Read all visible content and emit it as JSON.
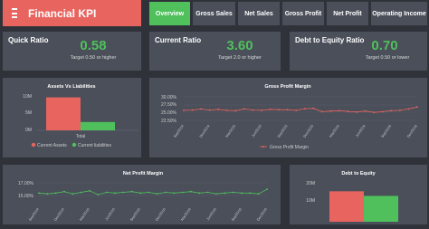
{
  "app": {
    "title": "Financial KPI",
    "menu_icon": "hamburger-icon"
  },
  "tabs": [
    {
      "label": "Overview",
      "active": true
    },
    {
      "label": "Gross Sales",
      "active": false
    },
    {
      "label": "Net Sales",
      "active": false
    },
    {
      "label": "Gross Profit",
      "active": false
    },
    {
      "label": "Net Profit",
      "active": false
    },
    {
      "label": "Operating Income",
      "active": false
    }
  ],
  "kpis": [
    {
      "label": "Quick Ratio",
      "value": "0.58",
      "target": "Target 0.50 or higher"
    },
    {
      "label": "Current Ratio",
      "value": "3.60",
      "target": "Target 2.0 or higher"
    },
    {
      "label": "Debt to Equity Ratio",
      "value": "0.70",
      "target": "Target 0.50 or lower"
    }
  ],
  "colors": {
    "accent_red": "#e8645f",
    "accent_green": "#4fc05b",
    "panel": "#4a4f5a",
    "background": "#2f3239"
  },
  "charts": {
    "assets_liabilities": {
      "title": "Assets Vs Liabilities",
      "y_ticks": [
        "10M",
        "5M",
        "0M"
      ],
      "category": "Total",
      "legend": [
        "Current Assets",
        "Current liabilities"
      ]
    },
    "gross_margin": {
      "title": "Gross Profit Margin",
      "y_ticks": [
        "30.00%",
        "27.50%",
        "25.00%",
        "22.50%"
      ],
      "legend": "Gross Profit Margin"
    },
    "net_margin": {
      "title": "Net Profit Margin",
      "y_ticks": [
        "17.00%",
        "15.00%"
      ]
    },
    "debt_equity": {
      "title": "Debt to Equity",
      "y_ticks": [
        "20M",
        "10M"
      ]
    }
  },
  "chart_data": [
    {
      "type": "bar",
      "title": "Assets Vs Liabilities",
      "categories": [
        "Total"
      ],
      "series": [
        {
          "name": "Current Assets",
          "values": [
            9.5
          ],
          "color": "#e8645f"
        },
        {
          "name": "Current liabilities",
          "values": [
            2.4
          ],
          "color": "#4fc05b"
        }
      ],
      "ylim": [
        0,
        12
      ],
      "y_unit": "M"
    },
    {
      "type": "line",
      "title": "Gross Profit Margin",
      "x": [
        "Sep/2014",
        "Oct/2014",
        "Nov/2014",
        "Dec/2014",
        "Jan/2015",
        "Feb/2015",
        "Mar/2015",
        "Apr/2015",
        "May/2015",
        "Jun/2015",
        "Jul/2015",
        "Aug/2015",
        "Sep/2015",
        "Oct/2015",
        "Nov/2015",
        "Dec/2015",
        "Jan/2016",
        "Feb/2016",
        "Mar/2016",
        "Apr/2016",
        "May/2016",
        "Jun/2016",
        "Jul/2016",
        "Aug/2016",
        "Sep/2016",
        "Oct/2016",
        "Nov/2016",
        "Dec/2016"
      ],
      "x_tick_labels": [
        "Sep/2014",
        "Dec/2014",
        "Mar/2015",
        "Jun/2015",
        "Sep/2015",
        "Dec/2015",
        "Mar/2016",
        "Jun/2016",
        "Sep/2016",
        "Dec/2016"
      ],
      "series": [
        {
          "name": "Gross Profit Margin",
          "color": "#e8645f",
          "values": [
            26.0,
            26.1,
            26.4,
            26.1,
            26.3,
            26.0,
            25.9,
            26.4,
            26.1,
            26.0,
            26.3,
            26.2,
            26.2,
            26.0,
            26.5,
            26.6,
            25.6,
            25.8,
            25.9,
            25.7,
            25.5,
            25.8,
            25.4,
            25.6,
            25.9,
            26.0,
            26.4,
            27.0
          ]
        }
      ],
      "ylim": [
        22.5,
        30.0
      ],
      "y_unit": "%"
    },
    {
      "type": "line",
      "title": "Net Profit Margin",
      "x": [
        "Sep/2014",
        "Oct/2014",
        "Nov/2014",
        "Dec/2014",
        "Jan/2015",
        "Feb/2015",
        "Mar/2015",
        "Apr/2015",
        "May/2015",
        "Jun/2015",
        "Jul/2015",
        "Aug/2015",
        "Sep/2015",
        "Oct/2015",
        "Nov/2015",
        "Dec/2015",
        "Jan/2016",
        "Feb/2016",
        "Mar/2016",
        "Apr/2016",
        "May/2016",
        "Jun/2016",
        "Jul/2016",
        "Aug/2016",
        "Sep/2016",
        "Oct/2016",
        "Nov/2016",
        "Dec/2016"
      ],
      "x_tick_labels": [
        "Sep/2014",
        "Dec/2014",
        "Mar/2015",
        "Jun/2015",
        "Sep/2015",
        "Dec/2015",
        "Mar/2016",
        "Jun/2016",
        "Sep/2016",
        "Dec/2016"
      ],
      "series": [
        {
          "name": "Net Profit Margin",
          "color": "#4fc05b",
          "values": [
            15.9,
            15.8,
            15.9,
            16.1,
            15.8,
            16.0,
            16.2,
            15.7,
            16.0,
            15.9,
            16.0,
            16.1,
            15.9,
            16.0,
            15.8,
            16.0,
            15.9,
            16.0,
            16.1,
            15.9,
            16.0,
            15.8,
            15.9,
            16.0,
            15.9,
            15.9,
            15.8,
            16.4
          ]
        }
      ],
      "ylim": [
        14.5,
        17.5
      ],
      "y_unit": "%"
    },
    {
      "type": "bar",
      "title": "Debt to Equity",
      "categories": [
        "Total"
      ],
      "series": [
        {
          "name": "Debt",
          "values": [
            16.5
          ],
          "color": "#e8645f"
        },
        {
          "name": "Equity",
          "values": [
            14.0
          ],
          "color": "#4fc05b"
        }
      ],
      "ylim": [
        0,
        25
      ],
      "y_unit": "M"
    }
  ]
}
